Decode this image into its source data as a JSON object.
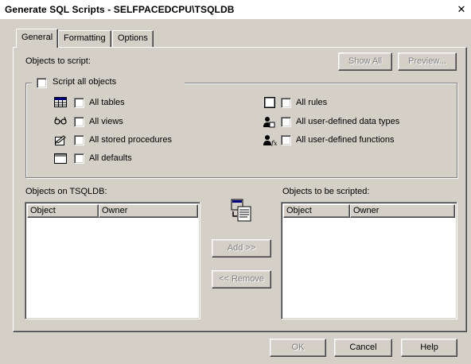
{
  "window": {
    "title": "Generate SQL Scripts - SELFPACEDCPU\\TSQLDB",
    "close_glyph": "✕"
  },
  "tabs": [
    {
      "label": "General"
    },
    {
      "label": "Formatting"
    },
    {
      "label": "Options"
    }
  ],
  "objects_to_script_label": "Objects to script:",
  "buttons": {
    "show_all": "Show All",
    "preview": "Preview...",
    "add": "Add >>",
    "remove": "<< Remove",
    "ok": "OK",
    "cancel": "Cancel",
    "help": "Help"
  },
  "script_all": {
    "label": "Script all objects",
    "checked": false
  },
  "options_left": [
    {
      "label": "All tables",
      "icon": "table-icon"
    },
    {
      "label": "All views",
      "icon": "view-glasses-icon"
    },
    {
      "label": "All stored procedures",
      "icon": "stored-procedure-icon"
    },
    {
      "label": "All defaults",
      "icon": "default-icon"
    }
  ],
  "options_right": [
    {
      "label": "All rules",
      "icon": "rule-icon"
    },
    {
      "label": "All user-defined data types",
      "icon": "user-data-type-icon"
    },
    {
      "label": "All user-defined functions",
      "icon": "user-function-icon"
    }
  ],
  "source_list": {
    "label": "Objects on TSQLDB:",
    "columns": [
      "Object",
      "Owner"
    ],
    "rows": []
  },
  "target_list": {
    "label": "Objects to be scripted:",
    "columns": [
      "Object",
      "Owner"
    ],
    "rows": []
  }
}
